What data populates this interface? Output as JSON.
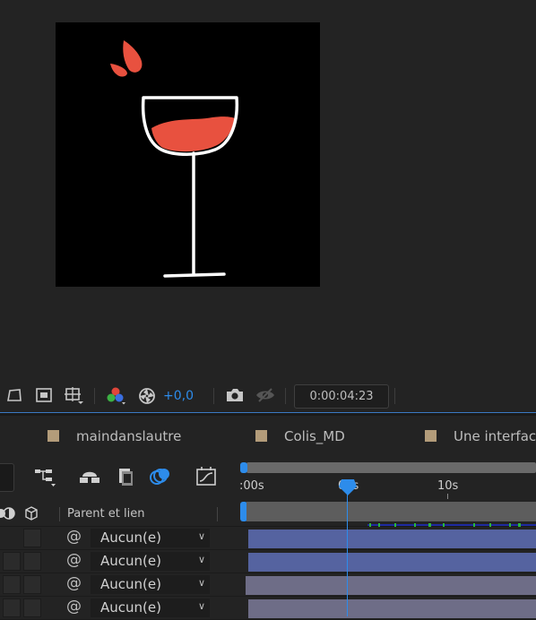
{
  "viewer": {
    "exposure_value": "+0,0",
    "timecode": "0:00:04:23"
  },
  "tabs": [
    {
      "label": "maindanslautre"
    },
    {
      "label": "Colis_MD"
    },
    {
      "label": "Une interfac"
    }
  ],
  "timeline": {
    "ruler_labels": [
      ":00s",
      "05s",
      "10s"
    ],
    "current_time_label": "05s",
    "column_parent_header": "Parent et lien",
    "layers": [
      {
        "parent": "Aucun(e)",
        "bar_color": "#5563a0"
      },
      {
        "parent": "Aucun(e)",
        "bar_color": "#5563a0"
      },
      {
        "parent": "Aucun(e)",
        "bar_color": "#6e6d87"
      },
      {
        "parent": "Aucun(e)",
        "bar_color": "#6e6d87"
      }
    ]
  },
  "colors": {
    "accent": "#2d8ceb",
    "wine": "#e8513f",
    "tab_swatch": "#b39c7a"
  }
}
